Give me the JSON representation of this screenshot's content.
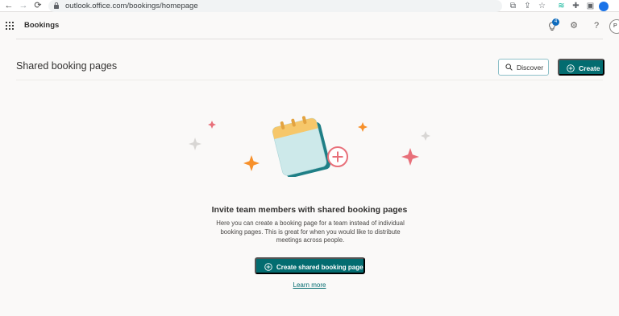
{
  "browser": {
    "url": "outlook.office.com/bookings/homepage",
    "back": "←",
    "forward": "→",
    "reload": "⟳"
  },
  "header": {
    "app_name": "Bookings",
    "notification_count": "4",
    "help": "?",
    "avatar_initial": "P"
  },
  "page": {
    "title": "Shared booking pages",
    "discover_label": "Discover",
    "create_label": "Create"
  },
  "empty_state": {
    "heading": "Invite team members with shared booking pages",
    "body": "Here you can create a booking page for a team instead of individual booking pages. This is great for when you would like to distribute meetings across people.",
    "cta_label": "Create shared booking page",
    "learn_more": "Learn more"
  },
  "colors": {
    "accent": "#036c70",
    "background": "#faf9f8"
  }
}
